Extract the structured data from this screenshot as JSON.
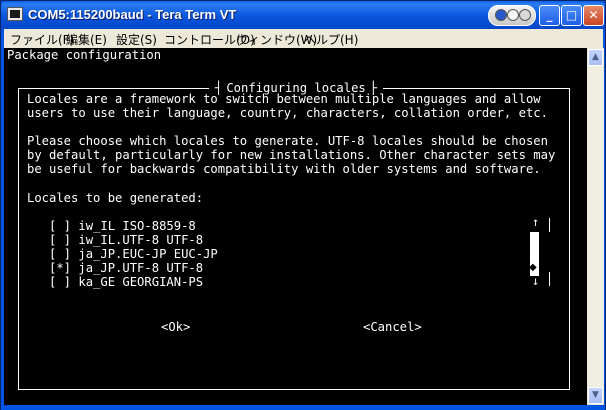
{
  "window": {
    "title": "COM5:115200baud - Tera Term VT",
    "controls": {
      "minimize": "_",
      "maximize": "□",
      "close": "✕"
    }
  },
  "menu": [
    "ファイル(F)",
    "編集(E)",
    "設定(S)",
    "コントロール(O)",
    "ウィンドウ(W)",
    "ヘルプ(H)"
  ],
  "terminal": {
    "header": "Package configuration",
    "dialog_title": "Configuring locales",
    "description": [
      "Locales are a framework to switch between multiple languages and allow",
      "users to use their language, country, characters, collation order, etc.",
      "",
      "Please choose which locales to generate. UTF-8 locales should be chosen",
      "by default, particularly for new installations. Other character sets may",
      "be useful for backwards compatibility with older systems and software."
    ],
    "list_label": "Locales to be generated:",
    "locales": [
      {
        "mark": "[ ]",
        "name": "iw_IL ISO-8859-8"
      },
      {
        "mark": "[ ]",
        "name": "iw_IL.UTF-8 UTF-8"
      },
      {
        "mark": "[ ]",
        "name": "ja_JP.EUC-JP EUC-JP"
      },
      {
        "mark": "[*]",
        "name": "ja_JP.UTF-8 UTF-8"
      },
      {
        "mark": "[ ]",
        "name": "ka_GE GEORGIAN-PS"
      }
    ],
    "scroll_up_glyph": "↑",
    "scroll_down_glyph": "↓",
    "ok_button": "<Ok>",
    "cancel_button": "<Cancel>"
  },
  "colors": {
    "terminal_bg": "#000000",
    "terminal_fg": "#ffffff",
    "titlebar": "#0054e3"
  }
}
